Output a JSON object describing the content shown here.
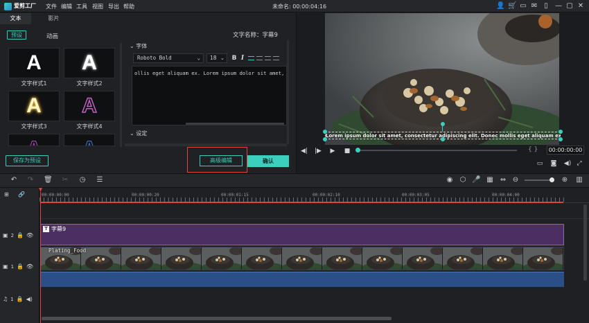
{
  "app": {
    "logo_text": "爱剪工厂",
    "menu": [
      "文件",
      "编辑",
      "工具",
      "视图",
      "导出",
      "帮助"
    ],
    "project_title": "未命名: 00:00:04:16"
  },
  "left": {
    "tabs": [
      "文本",
      "影片"
    ],
    "subtabs": [
      "预设",
      "动画"
    ],
    "style_letter": "A",
    "styles": [
      "文字样式1",
      "文字样式2",
      "文字样式3",
      "文字样式4"
    ],
    "save_preset": "保存为预设"
  },
  "editor": {
    "text_name_label": "文字名称：字幕9",
    "font_section": "字体",
    "font_name": "Roboto Bold",
    "font_size": "18",
    "bold_glyph": "B",
    "italic_glyph": "I",
    "text_content": "ollis eget aliquam ex. Lorem ipsum dolor sit amet, consectetu",
    "settings_section": "设定",
    "advanced_button": "高级编辑",
    "confirm_button": "确认"
  },
  "preview": {
    "caption_text": "Lorem ipsum dolor sit amet, consectetur adipiscing elit. Donec mollis eget aliquam ex. Lorem ipsum dolor sit amet, consectetur adipiscing",
    "timecode": "00:00:00:00",
    "progress": 0.0
  },
  "timeline": {
    "ruler_labels": [
      "00:00:00:00",
      "00:00:00:20",
      "00:00:01:15",
      "00:00:02:10",
      "00:00:03:05",
      "00:00:04:00"
    ],
    "tracks": [
      {
        "num": "2",
        "clip": "字幕9"
      },
      {
        "num": "1",
        "clip": "Plating_Food"
      },
      {
        "num": "1",
        "clip": ""
      }
    ]
  },
  "colors": {
    "accent": "#3ccfbe",
    "highlight": "#e0443a",
    "subtitle_clip": "#4b2f63",
    "audio": "#2a4f86"
  }
}
